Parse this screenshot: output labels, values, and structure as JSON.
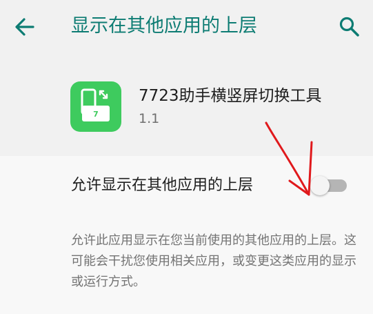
{
  "app_bar": {
    "title": "显示在其他应用的上层",
    "back_icon": "arrow-left-icon",
    "search_icon": "search-icon",
    "accent_color": "#0d7c73"
  },
  "app_info": {
    "name": "7723助手横竖屏切换工具",
    "version": "1.1",
    "icon": "rotate-screen-icon",
    "icon_badge": "7",
    "icon_color": "#3ecb5e"
  },
  "permission": {
    "label": "允许显示在其他应用的上层",
    "enabled": false,
    "description": "允许此应用显示在您当前使用的其他应用的上层。这可能会干扰您使用相关应用，或变更这类应用的显示或运行方式。"
  },
  "annotation": {
    "color": "#e0191c"
  }
}
